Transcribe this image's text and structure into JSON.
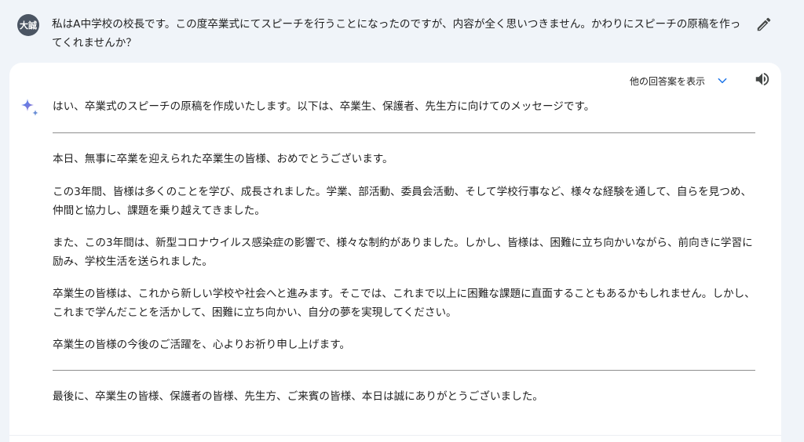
{
  "user": {
    "avatar_label": "大誠",
    "prompt": "私はA中学校の校長です。この度卒業式にてスピーチを行うことになったのですが、内容が全く思いつきません。かわりにスピーチの原稿を作ってくれませんか？"
  },
  "response": {
    "drafts_label": "他の回答案を表示",
    "intro": "はい、卒業式のスピーチの原稿を作成いたします。以下は、卒業生、保護者、先生方に向けてのメッセージです。",
    "paragraphs": [
      "本日、無事に卒業を迎えられた卒業生の皆様、おめでとうございます。",
      "この3年間、皆様は多くのことを学び、成長されました。学業、部活動、委員会活動、そして学校行事など、様々な経験を通して、自らを見つめ、仲間と協力し、課題を乗り越えてきました。",
      "また、この3年間は、新型コロナウイルス感染症の影響で、様々な制約がありました。しかし、皆様は、困難に立ち向かいながら、前向きに学習に励み、学校生活を送られました。",
      "卒業生の皆様は、これから新しい学校や社会へと進みます。そこでは、これまで以上に困難な課題に直面することもあるかもしれません。しかし、これまで学んだことを活かして、困難に立ち向かい、自分の夢を実現してください。",
      "卒業生の皆様の今後のご活躍を、心よりお祈り申し上げます。"
    ],
    "closing": "最後に、卒業生の皆様、保護者の皆様、先生方、ご来賓の皆様、本日は誠にありがとうございました。"
  },
  "icons": {
    "edit": "pencil-icon",
    "drafts_toggle": "chevron-down-icon",
    "read_aloud": "speaker-icon",
    "assistant": "sparkle-icon"
  },
  "colors": {
    "background": "#f0f4f9",
    "card": "#ffffff",
    "avatar": "#4b5563",
    "accent": "#1a73e8"
  }
}
